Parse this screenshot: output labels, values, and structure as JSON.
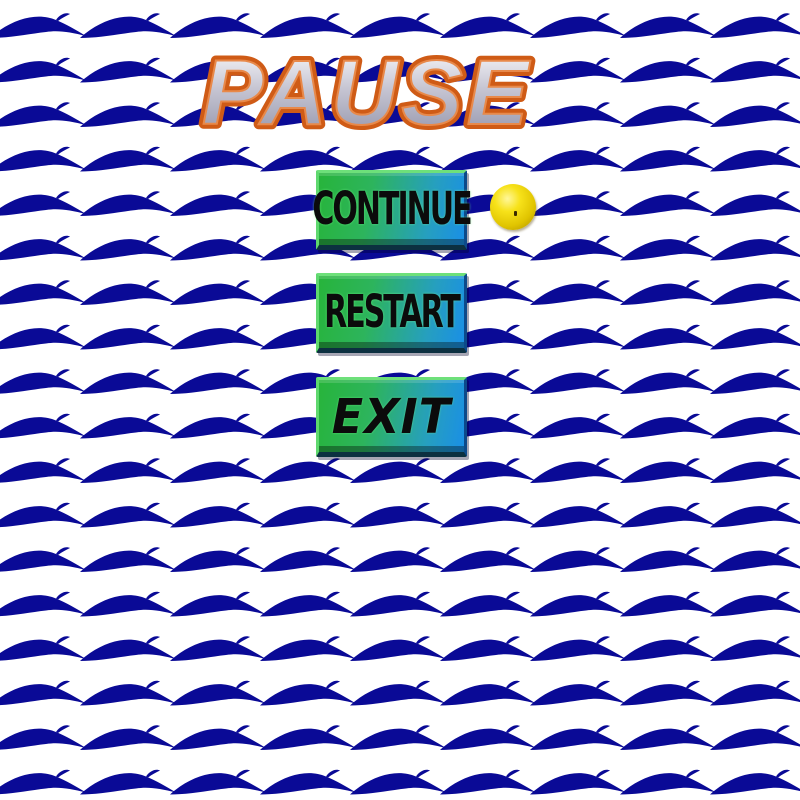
{
  "title": "PAUSE",
  "menu": {
    "items": [
      {
        "label": "CONTINUE",
        "selected": true
      },
      {
        "label": "RESTART",
        "selected": false
      },
      {
        "label": "EXIT",
        "selected": false
      }
    ]
  },
  "selector": {
    "icon": "yellow-ball-icon"
  },
  "colors": {
    "pattern_blue": "#0a0a96",
    "background": "#ffffff",
    "button_green": "#2db45c",
    "button_blue": "#1a8fe6",
    "title_fill": "#c9c9d4",
    "title_outline": "#d2651c",
    "ball_yellow": "#f7e21a"
  }
}
